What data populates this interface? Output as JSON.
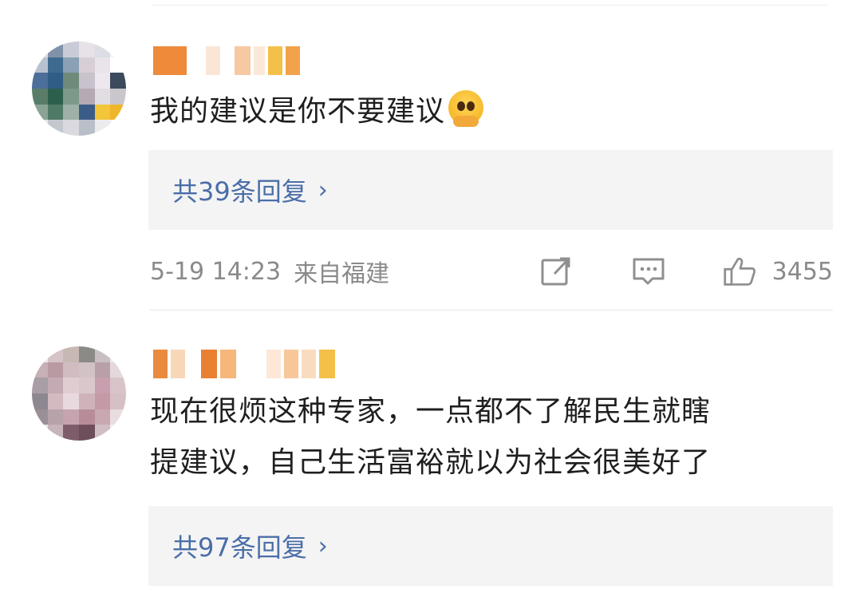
{
  "comments": [
    {
      "text": "我的建议是你不要建议",
      "emoji": "pleading-face-icon",
      "replies_label": "共39条回复",
      "reply_chevron": "›",
      "time": "5-19 14:23",
      "location": "来自福建",
      "likes": "3455"
    },
    {
      "text_line1": "现在很烦这种专家，一点都不了解民生就瞎",
      "text_line2": "提建议，自己生活富裕就以为社会很美好了",
      "replies_label": "共97条回复",
      "reply_chevron": "›"
    }
  ],
  "colors": {
    "reply_link": "#4a6ea8",
    "meta_gray": "#8a8a8a",
    "reply_bg": "#f4f4f4",
    "body_text": "#1f1f1f"
  },
  "icons": {
    "share": "share-icon",
    "comment": "comment-icon",
    "like": "thumbs-up-icon"
  }
}
